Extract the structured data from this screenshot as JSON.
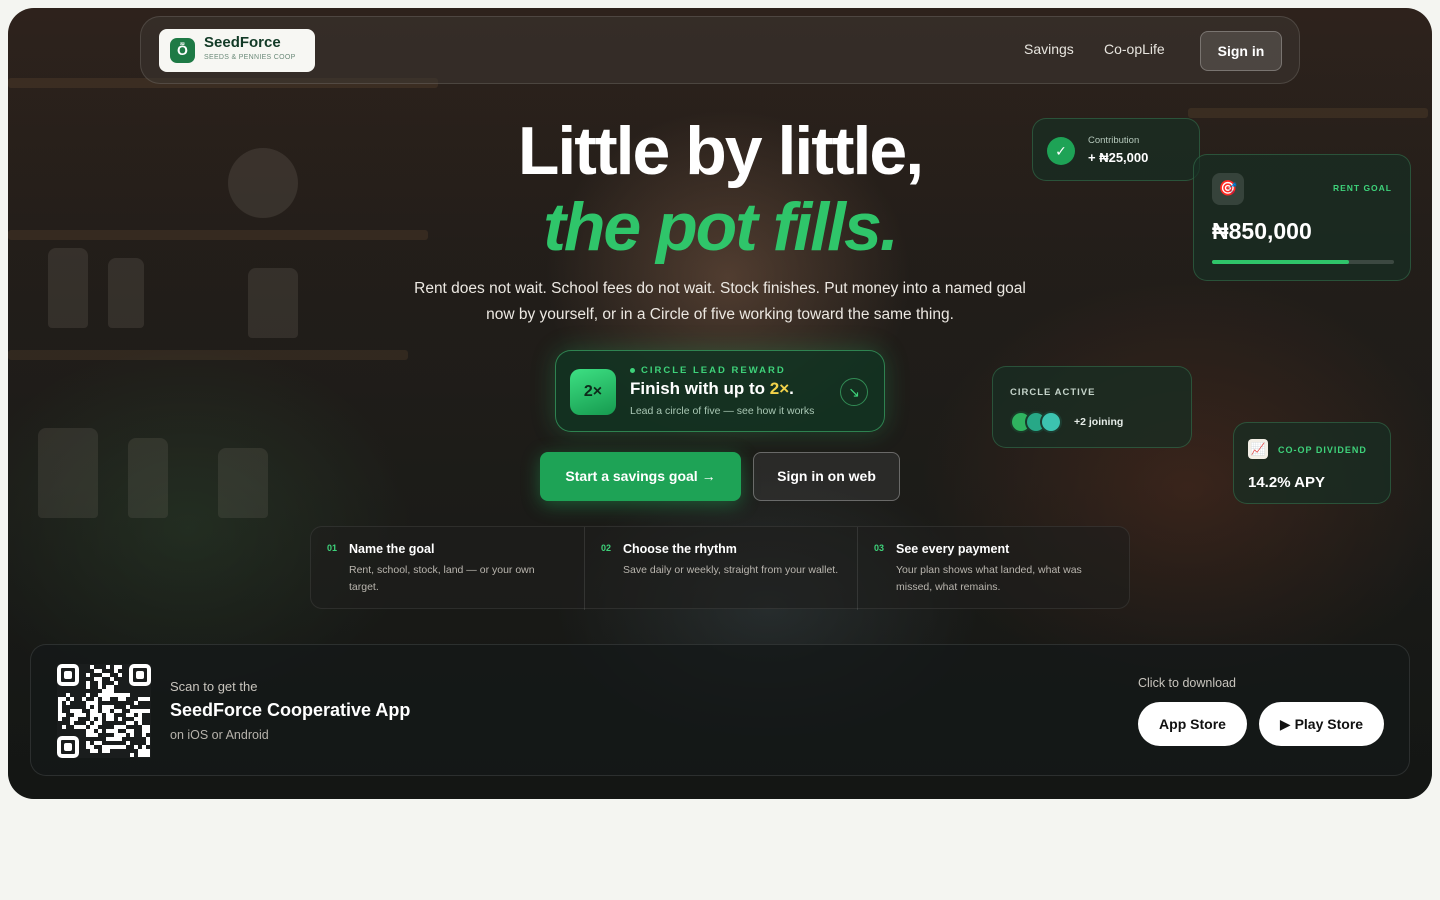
{
  "nav": {
    "logo_mark": "Ȭ",
    "brand_name": "SeedForce",
    "brand_tagline": "SEEDS & PENNIES COOP",
    "links": [
      "Savings",
      "Co-opLife"
    ],
    "signin_label": "Sign in"
  },
  "hero": {
    "headline_line1": "Little by little,",
    "headline_line2": "the pot fills.",
    "lead": "Rent does not wait. School fees do not wait. Stock finishes. Put money into a named goal now by yourself, or in a Circle of five working toward the same thing."
  },
  "reward": {
    "badge": "2×",
    "kicker": "CIRCLE LEAD REWARD",
    "title_prefix": "Finish with up to ",
    "title_multiplier": "2×",
    "title_suffix": ".",
    "subtitle": "Lead a circle of five — see how it works",
    "arrow_icon": "↘"
  },
  "cta": {
    "primary_label": "Start a savings goal →",
    "secondary_label": "Sign in on web"
  },
  "steps": [
    {
      "num": "01",
      "title": "Name the goal",
      "desc": "Rent, school, stock, land — or your own target."
    },
    {
      "num": "02",
      "title": "Choose the rhythm",
      "desc": "Save daily or weekly, straight from your wallet."
    },
    {
      "num": "03",
      "title": "See every payment",
      "desc": "Your plan shows what landed, what was missed, what remains."
    }
  ],
  "cards": {
    "contribution": {
      "check_icon": "✓",
      "label": "Contribution",
      "value": "+ ₦25,000"
    },
    "rent_goal": {
      "icon": "🎯",
      "label": "RENT GOAL",
      "value": "₦850,000",
      "progress_fraction": 0.75
    },
    "circle": {
      "label": "CIRCLE ACTIVE",
      "joining": "+2 joining",
      "avatar_colors": [
        "#2fb35f",
        "#27a887",
        "#3cc3b0"
      ]
    },
    "dividend": {
      "icon": "📈",
      "label": "CO-OP DIVIDEND",
      "value": "14.2% APY"
    }
  },
  "download": {
    "scan": "Scan to get the",
    "title": "SeedForce Cooperative App",
    "sub": "on iOS or Android",
    "click": "Click to download",
    "app_store": "App Store",
    "play_store": "▶ Play Store"
  },
  "colors": {
    "accent": "#2fc56a",
    "primary_button": "#1ea356",
    "highlight": "#f2d24a"
  }
}
